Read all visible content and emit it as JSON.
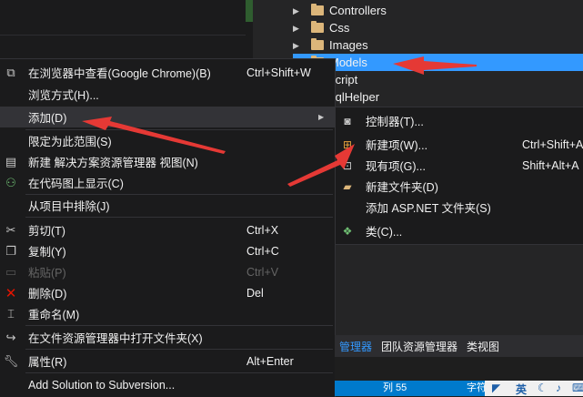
{
  "solution_explorer": {
    "items": [
      {
        "label": "Controllers"
      },
      {
        "label": "Css"
      },
      {
        "label": "Images"
      },
      {
        "label": "Models"
      },
      {
        "label": "Script"
      },
      {
        "label": "SqlHelper"
      }
    ]
  },
  "context_menu": {
    "items": [
      {
        "icon": "browser-icon",
        "label": "在浏览器中查看(Google Chrome)(B)",
        "shortcut": "Ctrl+Shift+W"
      },
      {
        "icon": "",
        "label": "浏览方式(H)...",
        "shortcut": ""
      },
      {
        "icon": "",
        "label": "添加(D)",
        "shortcut": ""
      },
      {
        "icon": "",
        "label": "限定为此范围(S)",
        "shortcut": ""
      },
      {
        "icon": "new-solution-view-icon",
        "label": "新建 解决方案资源管理器 视图(N)",
        "shortcut": ""
      },
      {
        "icon": "class-diagram-icon",
        "label": "在代码图上显示(C)",
        "shortcut": ""
      },
      {
        "icon": "",
        "label": "从项目中排除(J)",
        "shortcut": ""
      },
      {
        "icon": "cut-icon",
        "label": "剪切(T)",
        "shortcut": "Ctrl+X"
      },
      {
        "icon": "copy-icon",
        "label": "复制(Y)",
        "shortcut": "Ctrl+C"
      },
      {
        "icon": "paste-icon",
        "label": "粘贴(P)",
        "shortcut": "Ctrl+V"
      },
      {
        "icon": "delete-icon",
        "label": "删除(D)",
        "shortcut": "Del"
      },
      {
        "icon": "rename-icon",
        "label": "重命名(M)",
        "shortcut": ""
      },
      {
        "icon": "open-folder-icon",
        "label": "在文件资源管理器中打开文件夹(X)",
        "shortcut": ""
      },
      {
        "icon": "properties-icon",
        "label": "属性(R)",
        "shortcut": "Alt+Enter"
      },
      {
        "icon": "",
        "label": "Add Solution to Subversion...",
        "shortcut": ""
      }
    ]
  },
  "add_submenu": {
    "items": [
      {
        "icon": "controller-icon",
        "label": "控制器(T)...",
        "shortcut": ""
      },
      {
        "icon": "new-item-icon",
        "label": "新建项(W)...",
        "shortcut": "Ctrl+Shift+A"
      },
      {
        "icon": "existing-item-icon",
        "label": "现有项(G)...",
        "shortcut": "Shift+Alt+A"
      },
      {
        "icon": "new-folder-icon",
        "label": "新建文件夹(D)",
        "shortcut": ""
      },
      {
        "icon": "",
        "label": "添加 ASP.NET 文件夹(S)",
        "shortcut": ""
      },
      {
        "icon": "class-icon",
        "label": "类(C)...",
        "shortcut": ""
      }
    ]
  },
  "bottom_tabs": [
    {
      "label": "管理器"
    },
    {
      "label": "团队资源管理器"
    },
    {
      "label": "类视图"
    }
  ],
  "status_bar": {
    "col": "列 55",
    "chars": "字符",
    "ime": "英"
  },
  "colors": {
    "menu_bg": "#1b1b1c",
    "selection": "#3399ff",
    "arrow": "#e53935",
    "status": "#007acc"
  }
}
